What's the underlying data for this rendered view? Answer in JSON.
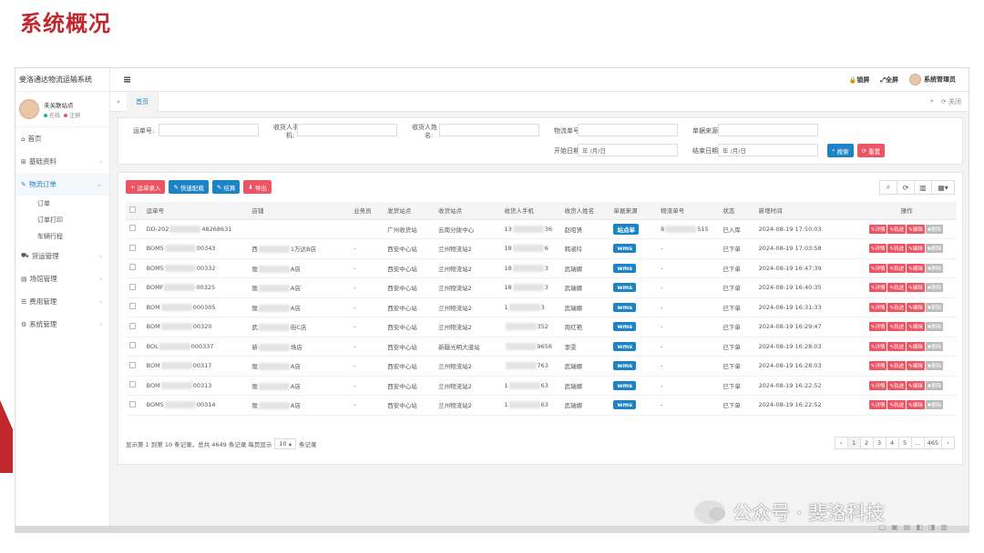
{
  "slide_title": "系统概况",
  "app": {
    "system_name": "斐洛通达物流运输系统",
    "user": {
      "name": "未关联站点",
      "online": "在线",
      "logout": "注销"
    },
    "nav": [
      {
        "icon": "home-icon",
        "label": "首页"
      },
      {
        "icon": "grid-icon",
        "label": "基础资料"
      },
      {
        "icon": "edit-icon",
        "label": "物流订单",
        "active": true
      },
      {
        "icon": "truck-icon",
        "label": "货运管理"
      },
      {
        "icon": "building-icon",
        "label": "场馆管理"
      },
      {
        "icon": "list-icon",
        "label": "费用管理"
      },
      {
        "icon": "gear-icon",
        "label": "系统管理"
      }
    ],
    "sub_nav": [
      "订单",
      "订单打印",
      "车辆行程"
    ],
    "topbar": {
      "lock": "锁屏",
      "fullscreen": "全屏",
      "admin": "系统管理员"
    },
    "tabs": {
      "home": "首页",
      "close": "关闭"
    }
  },
  "search": {
    "order_no": "运单号:",
    "receiver_phone_1": "收货人手",
    "receiver_phone_2": "机:",
    "receiver_name_1": "收货人姓",
    "receiver_name_2": "名:",
    "logistics_no": "物流单号:",
    "source": "单据来源:",
    "start_date": "开始日期:",
    "end_date": "结束日期:",
    "date_placeholder": "年 /月/日",
    "search_btn": "搜索",
    "reset_btn": "重置"
  },
  "toolbar": {
    "entry": "运单录入",
    "quick": "快速配载",
    "settle": "结算",
    "export": "导出"
  },
  "table": {
    "headers": [
      "运单号",
      "店铺",
      "业务员",
      "发货站点",
      "收货站点",
      "收货人手机",
      "收货人姓名",
      "单据来源",
      "物流单号",
      "状态",
      "新增时间",
      "操作"
    ],
    "rows": [
      {
        "no_a": "DD-202",
        "no_b": "48268631",
        "shop_a": "",
        "shop_b": "",
        "staff": "",
        "from": "广州收货站",
        "to": "云南分拨中心",
        "phone_a": "13",
        "phone_b": "36",
        "name": "赵昭贤",
        "source": "站点单",
        "logi_a": "8",
        "logi_b": "515",
        "status": "已入库",
        "time": "2024-08-19 17:50:03"
      },
      {
        "no_a": "BOM5",
        "no_b": "00343",
        "shop_a": "西",
        "shop_b": "1万达B店",
        "staff": "-",
        "from": "西安中心站",
        "to": "兰州物流站2",
        "phone_a": "18",
        "phone_b": "6",
        "name": "韩淑玲",
        "source": "wms",
        "logi_a": "-",
        "logi_b": "",
        "status": "已下单",
        "time": "2024-08-19 17:03:58"
      },
      {
        "no_a": "BOM5",
        "no_b": "00332",
        "shop_a": "陇",
        "shop_b": "A店",
        "staff": "-",
        "from": "西安中心站",
        "to": "兰州物流站2",
        "phone_a": "18",
        "phone_b": "3",
        "name": "武瑞娜",
        "source": "wms",
        "logi_a": "-",
        "logi_b": "",
        "status": "已下单",
        "time": "2024-08-19 16:47:39"
      },
      {
        "no_a": "BOMF",
        "no_b": "00325",
        "shop_a": "陇",
        "shop_b": "A店",
        "staff": "-",
        "from": "西安中心站",
        "to": "兰州物流站2",
        "phone_a": "18",
        "phone_b": "3",
        "name": "武瑞娜",
        "source": "wms",
        "logi_a": "-",
        "logi_b": "",
        "status": "已下单",
        "time": "2024-08-19 16:40:35"
      },
      {
        "no_a": "BOM",
        "no_b": "000305",
        "shop_a": "陇",
        "shop_b": "A店",
        "staff": "-",
        "from": "西安中心站",
        "to": "兰州物流站2",
        "phone_a": "1",
        "phone_b": "3",
        "name": "武瑞娜",
        "source": "wms",
        "logi_a": "-",
        "logi_b": "",
        "status": "已下单",
        "time": "2024-08-19 16:31:33"
      },
      {
        "no_a": "BOM",
        "no_b": "00320",
        "shop_a": "武",
        "shop_b": "街C店",
        "staff": "-",
        "from": "西安中心站",
        "to": "兰州物流站2",
        "phone_a": "",
        "phone_b": "352",
        "name": "周红艳",
        "source": "wms",
        "logi_a": "-",
        "logi_b": "",
        "status": "已下单",
        "time": "2024-08-19 16:29:47"
      },
      {
        "no_a": "BOL",
        "no_b": "000337",
        "shop_a": "新",
        "shop_b": "场店",
        "staff": "-",
        "from": "西安中心站",
        "to": "新疆光明大道站",
        "phone_a": "",
        "phone_b": "9656",
        "name": "李雯",
        "source": "wms",
        "logi_a": "-",
        "logi_b": "",
        "status": "已下单",
        "time": "2024-08-19 16:28:03"
      },
      {
        "no_a": "BOM",
        "no_b": "00317",
        "shop_a": "陇",
        "shop_b": "A店",
        "staff": "-",
        "from": "西安中心站",
        "to": "兰州物流站2",
        "phone_a": "",
        "phone_b": "763",
        "name": "武瑞娜",
        "source": "wms",
        "logi_a": "-",
        "logi_b": "",
        "status": "已下单",
        "time": "2024-08-19 16:28:03"
      },
      {
        "no_a": "BOM",
        "no_b": "00313",
        "shop_a": "陇",
        "shop_b": "A店",
        "staff": "-",
        "from": "西安中心站",
        "to": "兰州物流站2",
        "phone_a": "1",
        "phone_b": "63",
        "name": "武瑞娜",
        "source": "wms",
        "logi_a": "-",
        "logi_b": "",
        "status": "已下单",
        "time": "2024-08-19 16:22:52"
      },
      {
        "no_a": "BOM5",
        "no_b": "00314",
        "shop_a": "陇",
        "shop_b": "A店",
        "staff": "-",
        "from": "西安中心站",
        "to": "兰州物流站2",
        "phone_a": "1",
        "phone_b": "63",
        "name": "武瑞娜",
        "source": "wms",
        "logi_a": "-",
        "logi_b": "",
        "status": "已下单",
        "time": "2024-08-19 16:22:52"
      }
    ],
    "actions": [
      "详情",
      "轨迹",
      "编辑",
      "删除"
    ]
  },
  "pagination": {
    "info_left": "显示第 1 到第 10 条记录，总共 4649 条记录 每页显示",
    "page_size": "10",
    "info_right": "条记录",
    "pages": [
      "‹",
      "1",
      "2",
      "3",
      "4",
      "5",
      "...",
      "465",
      "›"
    ],
    "current": "1"
  },
  "watermark": "公众号 · 斐洛科技",
  "colors": {
    "accent": "#1c84c6",
    "danger": "#ed5565",
    "title_red": "#c0282e"
  }
}
